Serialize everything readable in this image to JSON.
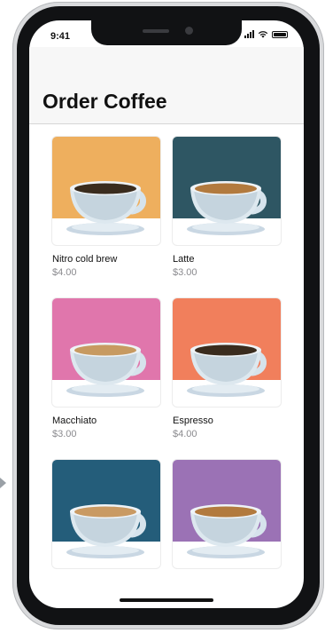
{
  "status_bar": {
    "time": "9:41"
  },
  "title": "Order Coffee",
  "products": [
    {
      "name": "Nitro cold brew",
      "price": "$4.00",
      "bg_color": "#eeaf5e",
      "coffee_color": "#3a2c1e"
    },
    {
      "name": "Latte",
      "price": "$3.00",
      "bg_color": "#2e5663",
      "coffee_color": "#b27a3e"
    },
    {
      "name": "Macchiato",
      "price": "$3.00",
      "bg_color": "#e076ac",
      "coffee_color": "#c79a61"
    },
    {
      "name": "Espresso",
      "price": "$4.00",
      "bg_color": "#f17f5c",
      "coffee_color": "#3a2c1e"
    },
    {
      "name": "",
      "price": "",
      "bg_color": "#245d7a",
      "coffee_color": "#c99a63"
    },
    {
      "name": "",
      "price": "",
      "bg_color": "#9b72b5",
      "coffee_color": "#b27a3e"
    }
  ]
}
